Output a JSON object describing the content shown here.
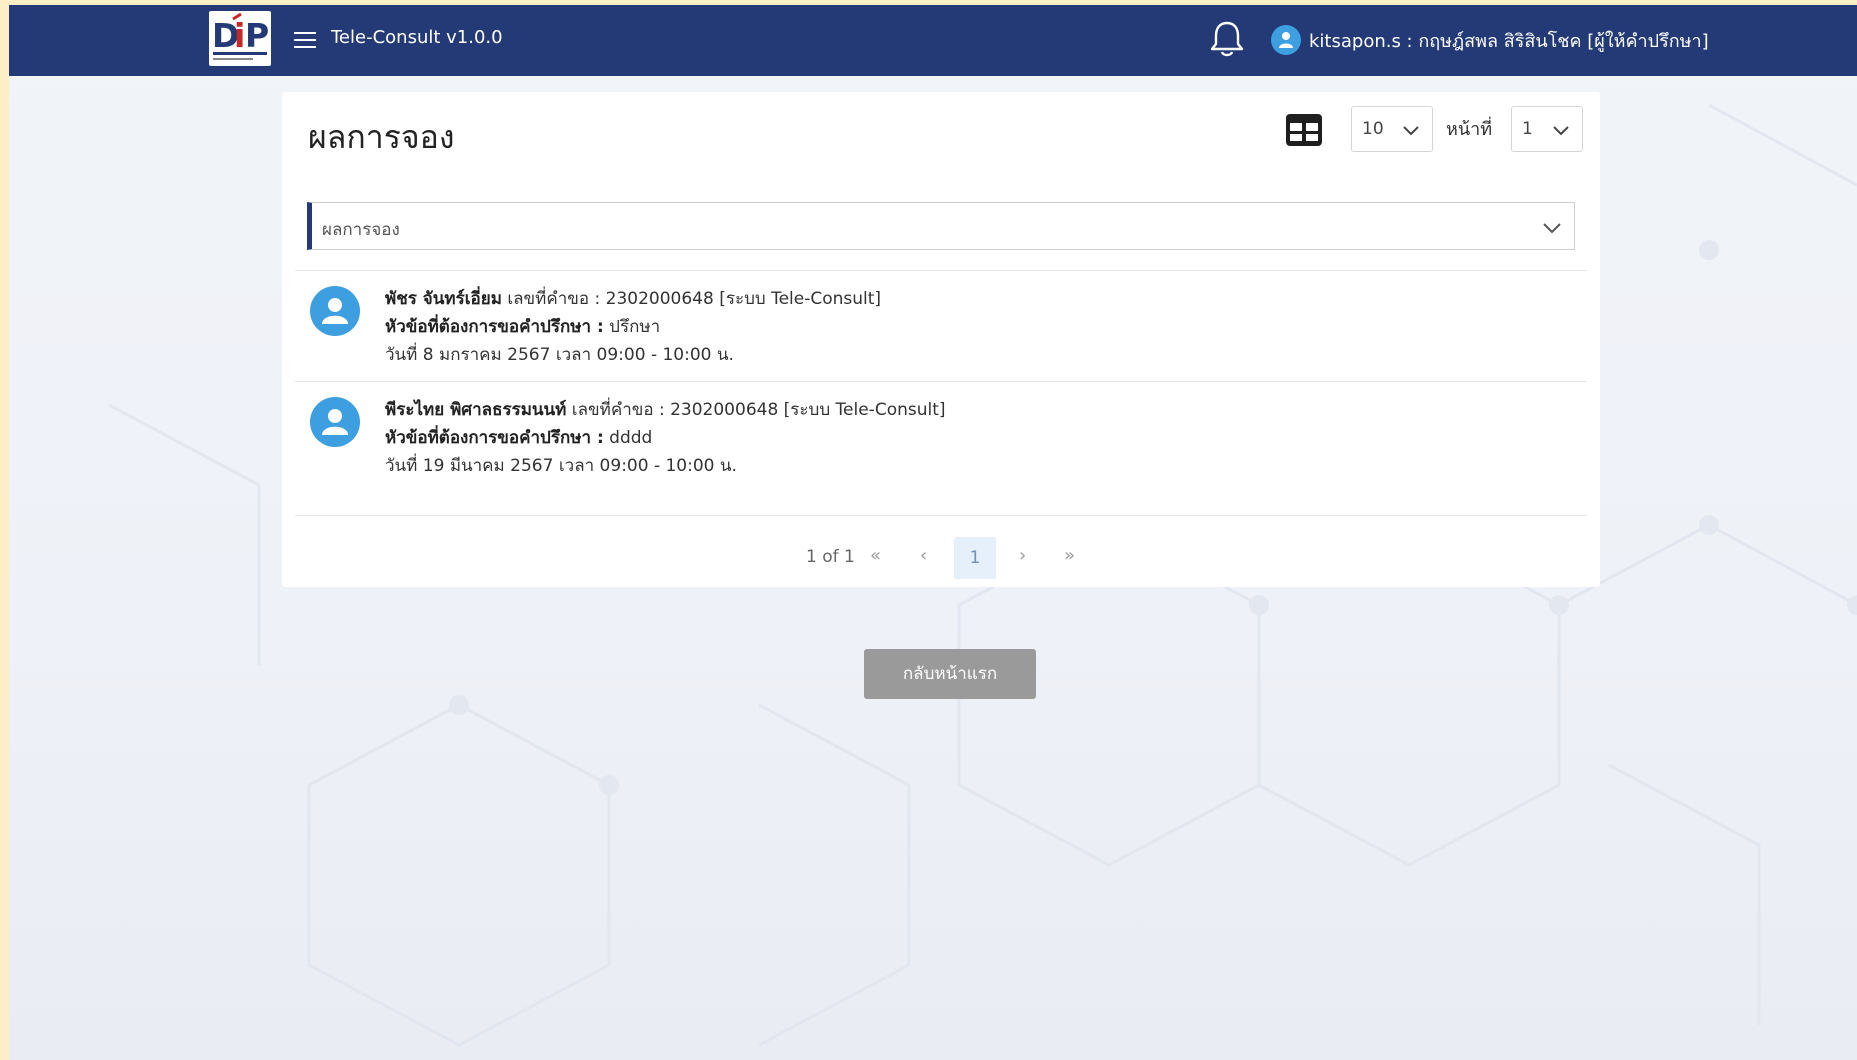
{
  "header": {
    "logo_text": "DiP",
    "logo_subtext": "กรมทรัพย์สินทางปัญญา",
    "app_title": "Tele-Consult v1.0.0",
    "user_label": "kitsapon.s : กฤษฎ์สพล สิริสินโชค [ผู้ให้คำปรึกษา]"
  },
  "main": {
    "title": "ผลการจอง",
    "page_size": "10",
    "page_label": "หน้าที่",
    "page_number": "1",
    "filter_value": "ผลการจอง",
    "items": [
      {
        "name": "พัชร จันทร์เอี่ยม",
        "ref": "เลขที่คำขอ : 2302000648 [ระบบ Tele-Consult]",
        "topic_label": "หัวข้อที่ต้องการขอคำปรึกษา :",
        "topic_value": "ปรึกษา",
        "datetime": "วันที่ 8 มกราคม 2567 เวลา 09:00 - 10:00 น."
      },
      {
        "name": "พีระไทย พิศาลธรรมนนท์",
        "ref": "เลขที่คำขอ : 2302000648 [ระบบ Tele-Consult]",
        "topic_label": "หัวข้อที่ต้องการขอคำปรึกษา :",
        "topic_value": "dddd",
        "datetime": "วันที่ 19 มีนาคม 2567 เวลา 09:00 - 10:00 น."
      }
    ],
    "pagination": {
      "summary": "1 of 1",
      "first": "«",
      "prev": "‹",
      "current": "1",
      "next": "›",
      "last": "»"
    }
  },
  "footer": {
    "home_button": "กลับหน้าแรก"
  },
  "colors": {
    "header_bg": "#233a77",
    "avatar": "#3d9ee0",
    "outer_bg": "#fdeec5",
    "button_bg": "#9a9a9a"
  }
}
